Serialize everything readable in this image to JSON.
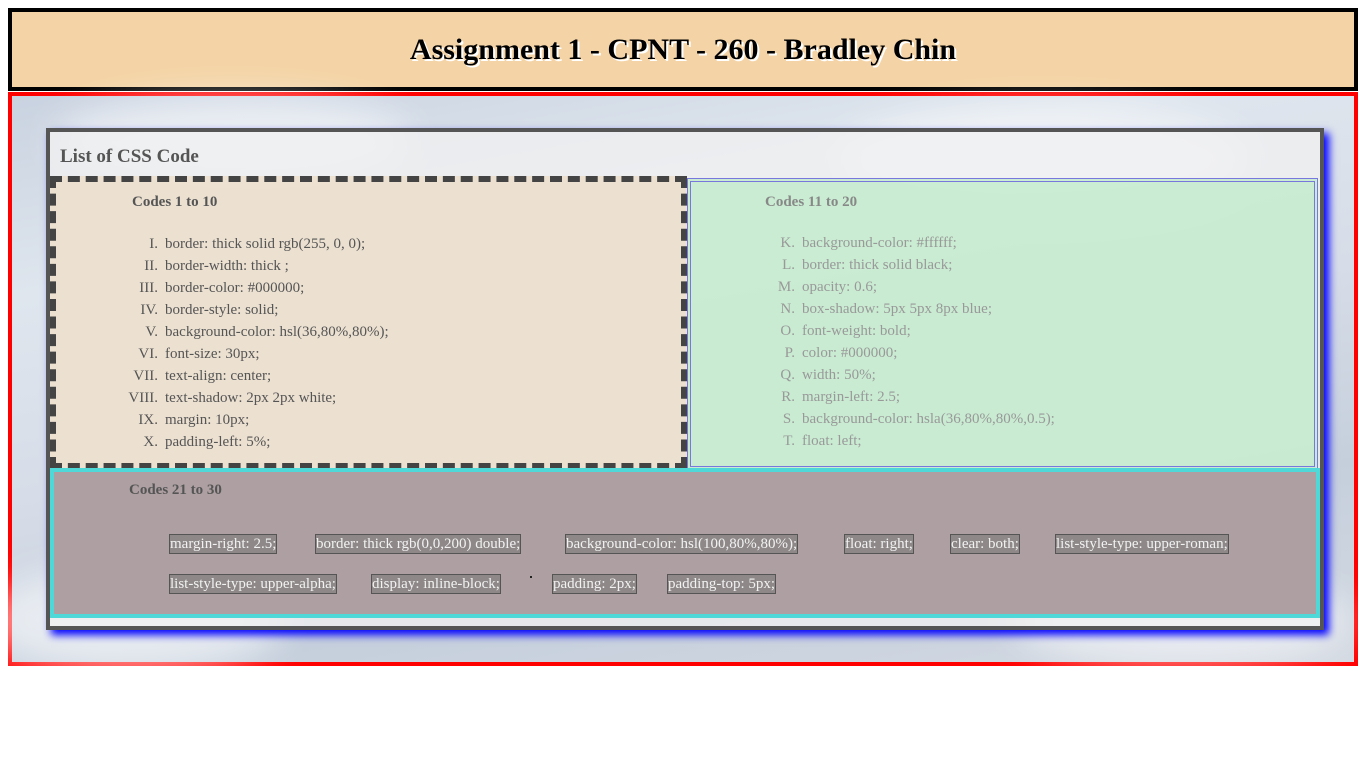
{
  "header": {
    "title": "Assignment 1 - CPNT - 260 - Bradley Chin"
  },
  "panel": {
    "title": "List of CSS Code"
  },
  "codes_1_10": {
    "title": "Codes 1 to 10",
    "items": [
      {
        "marker": "I.",
        "text": "border: thick solid rgb(255, 0, 0);"
      },
      {
        "marker": "II.",
        "text": "border-width: thick ;"
      },
      {
        "marker": "III.",
        "text": "border-color: #000000;"
      },
      {
        "marker": "IV.",
        "text": "border-style: solid;"
      },
      {
        "marker": "V.",
        "text": "background-color: hsl(36,80%,80%);"
      },
      {
        "marker": "VI.",
        "text": "font-size: 30px;"
      },
      {
        "marker": "VII.",
        "text": "text-align: center;"
      },
      {
        "marker": "VIII.",
        "text": "text-shadow: 2px 2px white;"
      },
      {
        "marker": "IX.",
        "text": "margin: 10px;"
      },
      {
        "marker": "X.",
        "text": "padding-left: 5%;"
      }
    ]
  },
  "codes_11_20": {
    "title": "Codes 11 to 20",
    "items": [
      {
        "marker": "K.",
        "text": "background-color: #ffffff;"
      },
      {
        "marker": "L.",
        "text": "border: thick solid black;"
      },
      {
        "marker": "M.",
        "text": "opacity: 0.6;"
      },
      {
        "marker": "N.",
        "text": "box-shadow: 5px 5px 8px blue;"
      },
      {
        "marker": "O.",
        "text": "font-weight: bold;"
      },
      {
        "marker": "P.",
        "text": "color: #000000;"
      },
      {
        "marker": "Q.",
        "text": "width: 50%;"
      },
      {
        "marker": "R.",
        "text": "margin-left: 2.5;"
      },
      {
        "marker": "S.",
        "text": "background-color: hsla(36,80%,80%,0.5);"
      },
      {
        "marker": "T.",
        "text": "float: left;"
      }
    ]
  },
  "codes_21_30": {
    "title": "Codes 21 to 30",
    "items": [
      "margin-right: 2.5;",
      "border: thick rgb(0,0,200) double;",
      "background-color: hsl(100,80%,80%);",
      "float: right;",
      "clear: both;",
      "list-style-type: upper-roman;",
      "list-style-type: upper-alpha;",
      "display: inline-block;",
      "padding: 2px;",
      "padding-top: 5px;"
    ]
  },
  "colors": {
    "header_bg": "#f4d4a6",
    "main_border": "#ff0000",
    "panel_border": "#555555",
    "box2_bg": "#bfeec8",
    "box3_border": "#4fd8d8",
    "box3_bg": "#ad9fa2"
  }
}
